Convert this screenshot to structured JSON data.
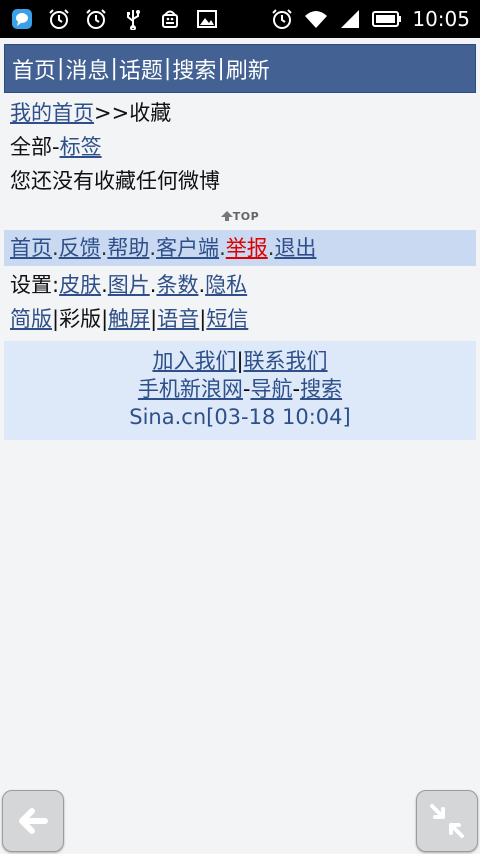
{
  "status_bar": {
    "time": "10:05",
    "left_icons": [
      "chat-bubble-icon",
      "alarm-icon",
      "alarm-icon",
      "usb-icon",
      "android-debug-icon",
      "image-icon"
    ],
    "right_icons": [
      "alarm-icon",
      "wifi-icon",
      "signal-icon",
      "battery-icon"
    ]
  },
  "top_nav": {
    "items": [
      "首页",
      "消息",
      "话题",
      "搜索",
      "刷新"
    ],
    "separator": "|"
  },
  "breadcrumb": {
    "home_link": "我的首页",
    "arrow": ">>",
    "current": "收藏"
  },
  "filter": {
    "all": "全部",
    "dash": "-",
    "tags_link": "标签"
  },
  "empty_message": "您还没有收藏任何微博",
  "top_marker": "TOP",
  "bottom_links": {
    "home": "首页",
    "feedback": "反馈",
    "help": "帮助",
    "client": "客户端",
    "report": "举报",
    "logout": "退出",
    "dot": "."
  },
  "settings": {
    "label": "设置:",
    "skin": "皮肤",
    "images": "图片",
    "count": "条数",
    "privacy": "隐私",
    "dot": "."
  },
  "versions": {
    "simple": "简版",
    "color": "彩版",
    "touch": "触屏",
    "voice": "语音",
    "sms": "短信",
    "separator": "|"
  },
  "footer": {
    "join": "加入我们",
    "contact": "联系我们",
    "separator": "|",
    "mobile_sina": "手机新浪网",
    "navigation": "导航",
    "search": "搜索",
    "dash": "-",
    "site_time": "Sina.cn[03-18 10:04]"
  },
  "colors": {
    "nav_bg": "#436193",
    "link": "#2e4f8a",
    "report": "#e00000",
    "linkbar_bg": "#c8d9f1",
    "footer_bg": "#dde9f8"
  },
  "floating_buttons": [
    "back-arrow-icon",
    "collapse-icon"
  ]
}
